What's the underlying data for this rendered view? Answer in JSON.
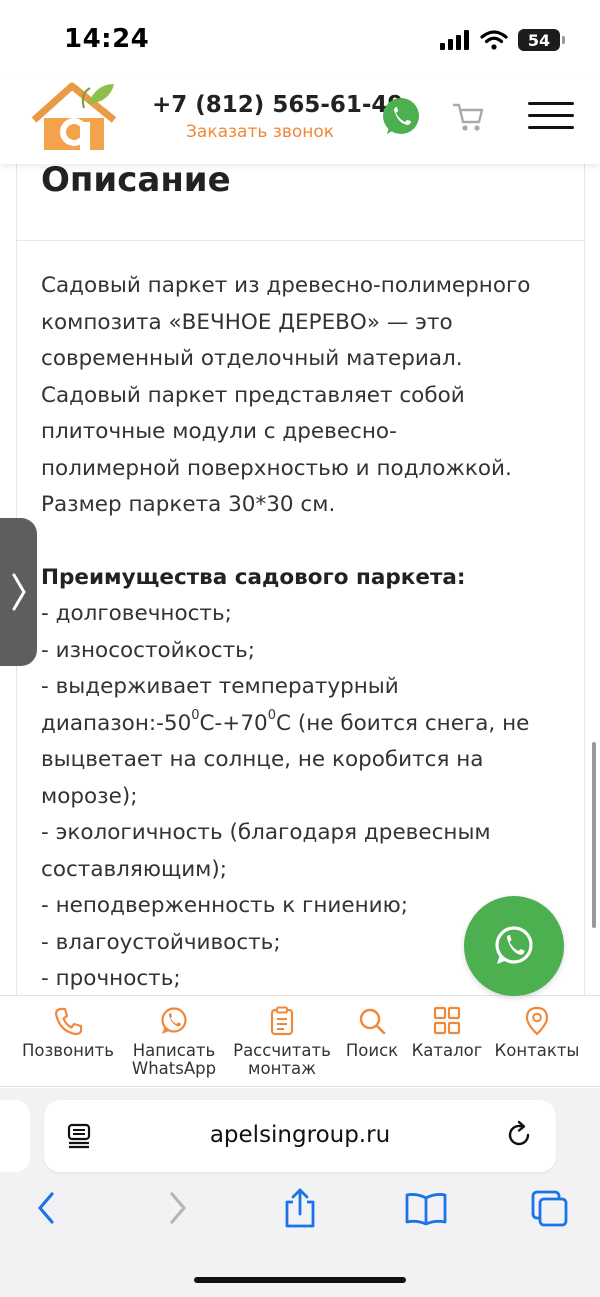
{
  "status_bar": {
    "time": "14:24",
    "battery": "54"
  },
  "header": {
    "phone": "+7 (812) 565-61-49",
    "callback_label": "Заказать звонок"
  },
  "content": {
    "title": "Описание",
    "paragraph_lines": [
      "Садовый паркет из древесно-полимерного",
      "композита «ВЕЧНОЕ ДЕРЕВО» — это",
      "современный отделочный материал.",
      "Садовый паркет представляет собой",
      "плиточные модули с древесно-",
      "полимерной поверхностью и подложкой.",
      "Размер паркета 30*30 см."
    ],
    "advantages_title": "Преимущества садового паркета:",
    "adv_1": "- долговечность;",
    "adv_2": "- износостойкость;",
    "adv_3_line1": "- выдерживает температурный",
    "adv_3_a": "диапазон:-50",
    "adv_3_sup1": "0",
    "adv_3_b": "С-+70",
    "adv_3_sup2": "0",
    "adv_3_c": "С (не боится снега, не",
    "adv_3_line3": "выцветает на солнце, не коробится на",
    "adv_3_line4": "морозе);",
    "adv_4_line1": "- экологичность (благодаря древесным",
    "adv_4_line2": "составляющим);",
    "adv_5": "- неподверженность к гниению;",
    "adv_6": "- влагоустойчивость;",
    "adv_7": "- прочность;"
  },
  "bottom_nav": {
    "call": "Позвонить",
    "whatsapp": "Написать\nWhatsApp",
    "calc": "Рассчитать\nмонтаж",
    "search": "Поиск",
    "catalog": "Каталог",
    "contacts": "Контакты"
  },
  "browser": {
    "url": "apelsingroup.ru"
  },
  "colors": {
    "accent_orange": "#f0883a",
    "whatsapp_green": "#4caf50"
  }
}
